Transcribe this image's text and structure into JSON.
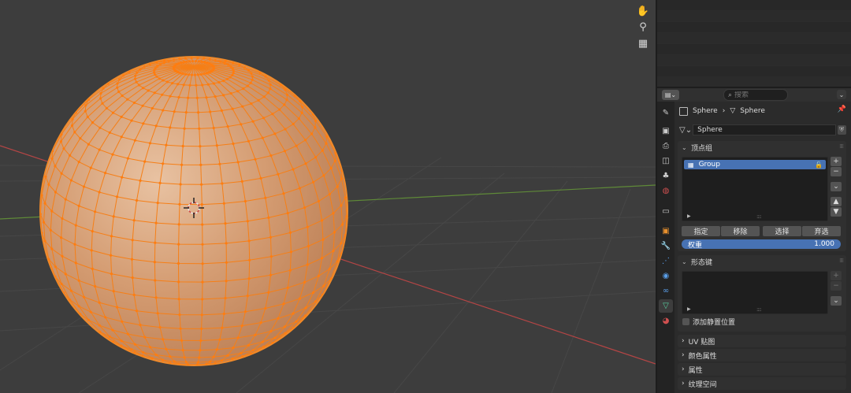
{
  "header": {
    "search_placeholder": "搜索",
    "editor_type_icon": "properties-icon",
    "dropdown_glyph": "⌄"
  },
  "viewport": {
    "nav_icons": [
      "hand-pan-icon",
      "camera-view-icon",
      "perspective-grid-icon"
    ],
    "object_color": "#f57f17",
    "surface_color": "#d39a72"
  },
  "breadcrumb": {
    "object_name": "Sphere",
    "mesh_name": "Sphere"
  },
  "mesh_datablock": {
    "name": "Sphere"
  },
  "vertex_groups": {
    "title": "顶点组",
    "items": [
      {
        "label": "Group"
      }
    ],
    "buttons": [
      "指定",
      "移除",
      "选择",
      "弃选"
    ],
    "weight_label": "权重",
    "weight_value": "1.000"
  },
  "shape_keys": {
    "title": "形态键",
    "relative_label": "添加静置位置"
  },
  "collapsed_panels": [
    "UV 贴图",
    "颜色属性",
    "属性",
    "纹理空间"
  ],
  "tabs": [
    "tool",
    "render",
    "output",
    "view-layer",
    "scene",
    "world",
    "collection",
    "object",
    "modifier",
    "particles",
    "physics",
    "constraints",
    "data",
    "material"
  ],
  "colors": {
    "accent": "#4772b3",
    "axis_x": "#c04a4a",
    "axis_y": "#6a9a3a"
  }
}
